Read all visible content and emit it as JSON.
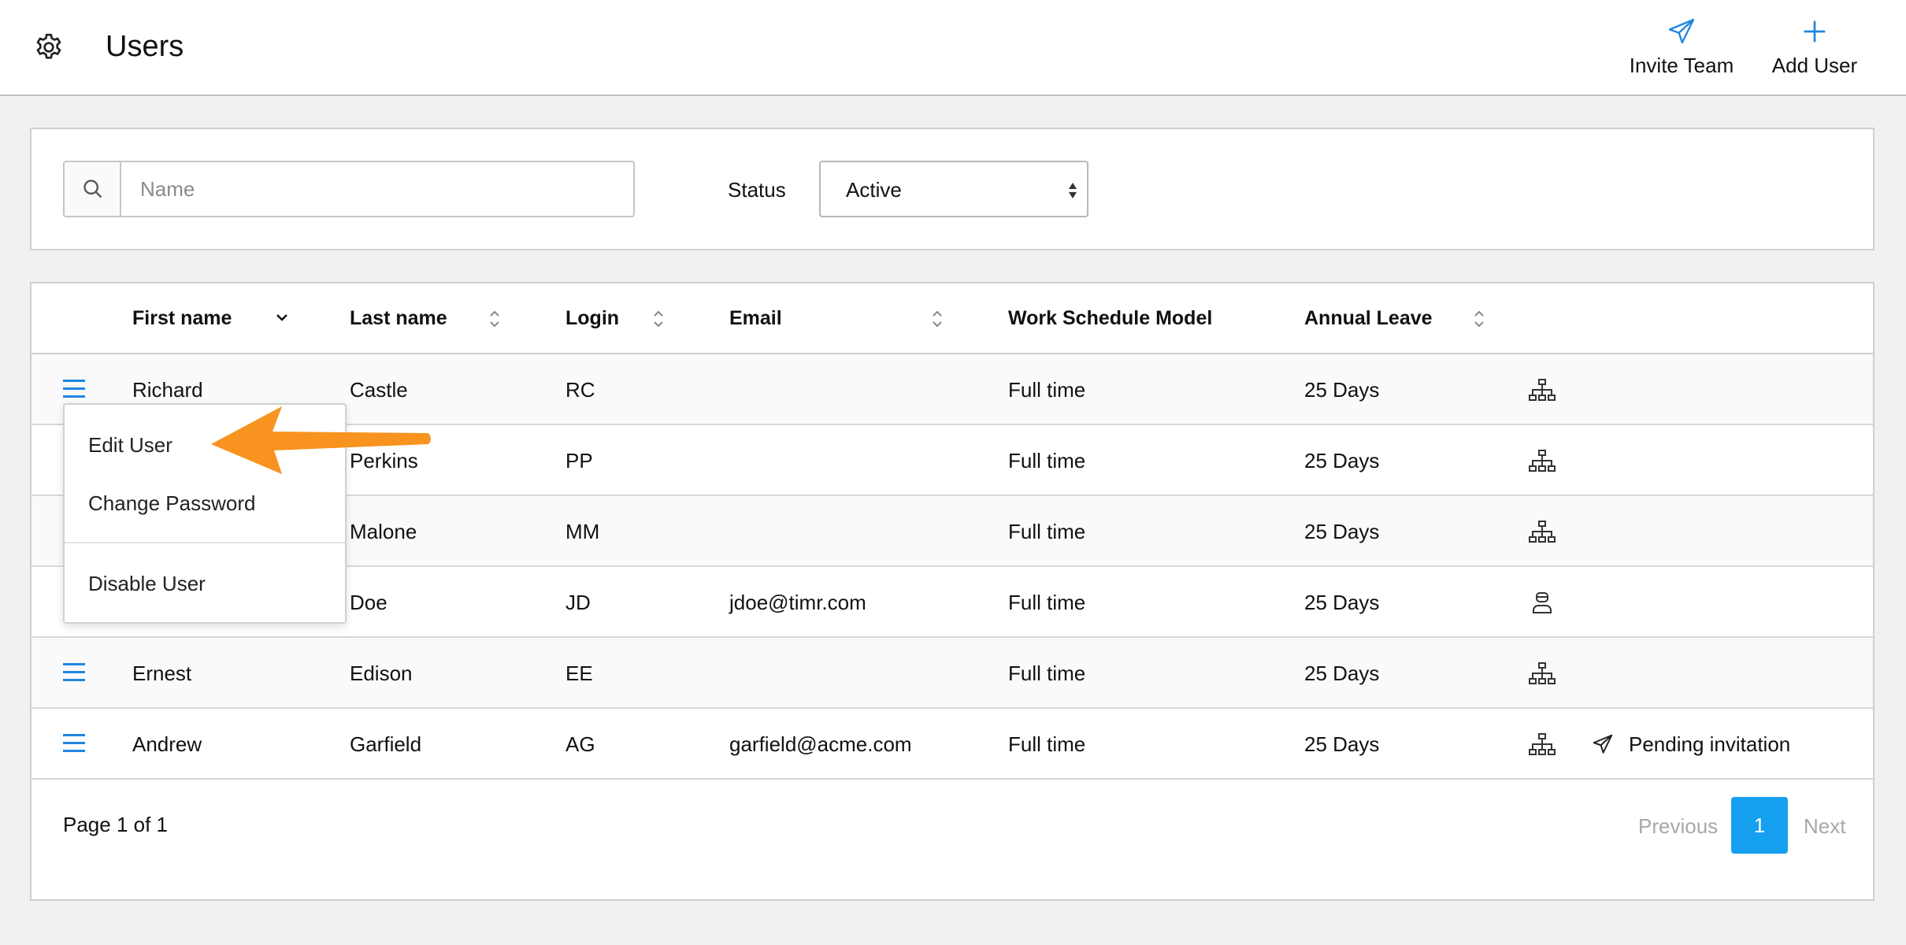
{
  "header": {
    "title": "Users",
    "settings_icon": "gear-icon",
    "invite_team": {
      "label": "Invite Team",
      "icon": "paper-plane-icon"
    },
    "add_user": {
      "label": "Add User",
      "icon": "plus-icon"
    }
  },
  "filters": {
    "search": {
      "placeholder": "Name",
      "value": "",
      "icon": "search-icon"
    },
    "status": {
      "label": "Status",
      "selected": "Active"
    }
  },
  "table": {
    "columns": [
      {
        "label": "First name",
        "sort": "desc"
      },
      {
        "label": "Last name",
        "sort": "sortable"
      },
      {
        "label": "Login",
        "sort": "sortable"
      },
      {
        "label": "Email",
        "sort": "sortable"
      },
      {
        "label": "Work Schedule Model",
        "sort": "none"
      },
      {
        "label": "Annual Leave",
        "sort": "sortable"
      }
    ],
    "rows": [
      {
        "first": "Richard",
        "last": "Castle",
        "login": "RC",
        "email": "",
        "schedule": "Full time",
        "leave": "25 Days",
        "icon": "org-chart-icon",
        "status": ""
      },
      {
        "first": "",
        "last": "Perkins",
        "login": "PP",
        "email": "",
        "schedule": "Full time",
        "leave": "25 Days",
        "icon": "org-chart-icon",
        "status": ""
      },
      {
        "first": "",
        "last": "Malone",
        "login": "MM",
        "email": "",
        "schedule": "Full time",
        "leave": "25 Days",
        "icon": "org-chart-icon",
        "status": ""
      },
      {
        "first": "",
        "last": "Doe",
        "login": "JD",
        "email": "jdoe@timr.com",
        "schedule": "Full time",
        "leave": "25 Days",
        "icon": "admin-user-icon",
        "status": ""
      },
      {
        "first": "Ernest",
        "last": "Edison",
        "login": "EE",
        "email": "",
        "schedule": "Full time",
        "leave": "25 Days",
        "icon": "org-chart-icon",
        "status": ""
      },
      {
        "first": "Andrew",
        "last": "Garfield",
        "login": "AG",
        "email": "garfield@acme.com",
        "schedule": "Full time",
        "leave": "25 Days",
        "icon": "org-chart-icon",
        "status": "Pending invitation"
      }
    ]
  },
  "pagination": {
    "info": "Page 1 of 1",
    "previous": "Previous",
    "current": "1",
    "next": "Next"
  },
  "context_menu": {
    "items": [
      "Edit User",
      "Change Password",
      "Disable User"
    ]
  },
  "colors": {
    "accent": "#16a0f0",
    "icon_blue": "#1f86e0",
    "annotation_arrow": "#f7931e"
  }
}
